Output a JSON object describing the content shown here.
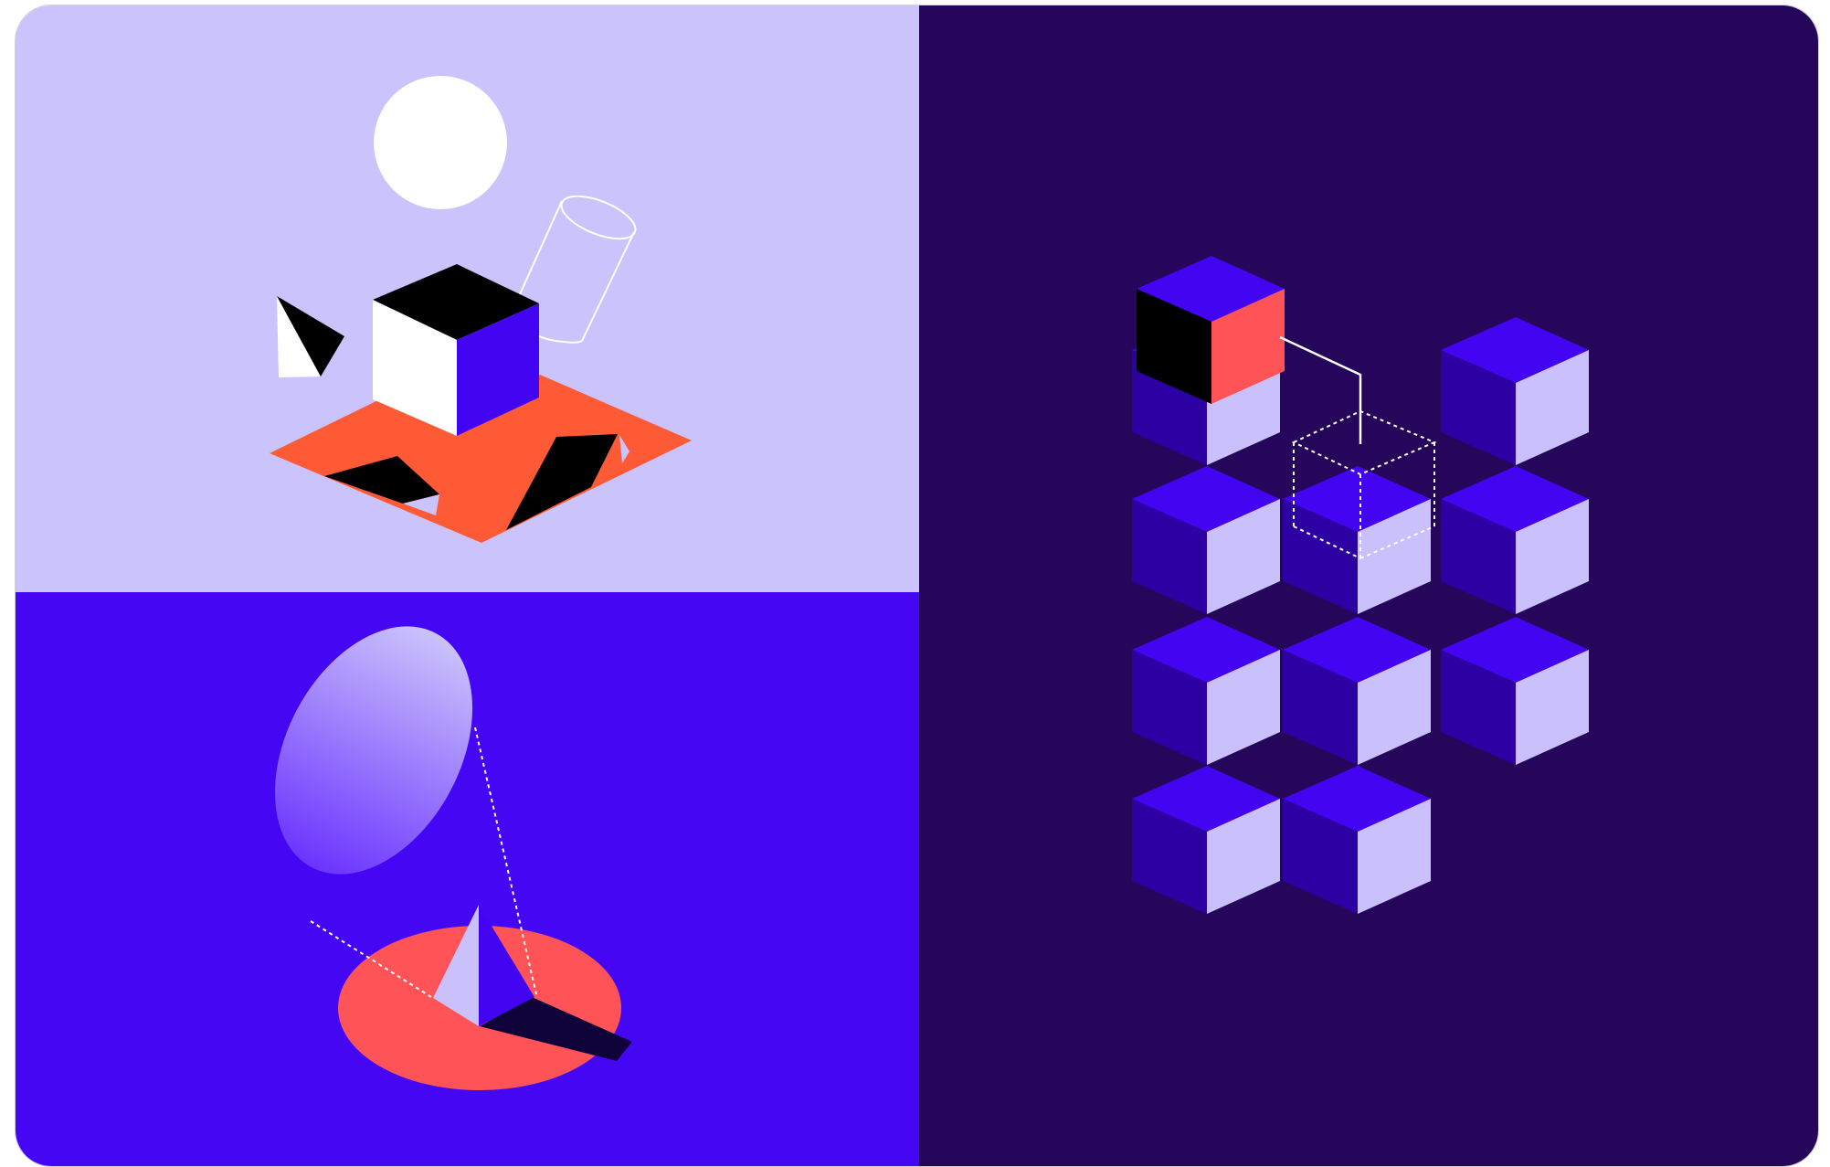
{
  "colors": {
    "lavender": "#CBC3FB",
    "electric_violet": "#4507F3",
    "deep_purple": "#25065A",
    "coral": "#FF5A36",
    "salmon": "#FF5457",
    "black": "#000000",
    "white": "#FFFFFF",
    "cube_top": "#4304F2",
    "cube_left": "#2D00A4",
    "cube_right": "#C9C0FC"
  },
  "illustration": {
    "panels": [
      "top-left-scene",
      "bottom-left-scene",
      "right-cube-grid"
    ],
    "icons": [
      "sphere-icon",
      "cube-icon",
      "cylinder-outline-icon",
      "pyramid-icon",
      "ellipse-icon",
      "cube-grid-icon"
    ]
  }
}
